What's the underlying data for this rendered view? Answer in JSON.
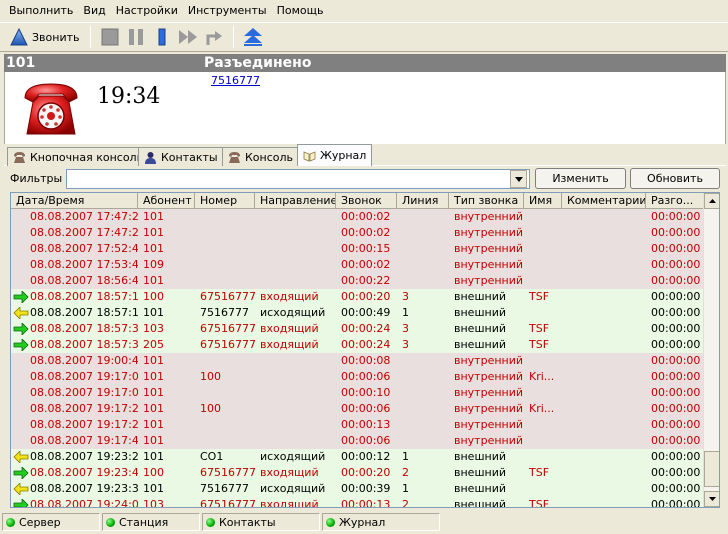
{
  "menu": [
    "Выполнить",
    "Вид",
    "Настройки",
    "Инструменты",
    "Помощь"
  ],
  "toolbar": {
    "call_label": "Звонить"
  },
  "call": {
    "line": "101",
    "state": "Разъединено",
    "time": "19:34",
    "number": "7516777"
  },
  "tabs": [
    {
      "label": "Кнопочная консоль",
      "icon": "phone-icon"
    },
    {
      "label": "Контакты",
      "icon": "person-icon"
    },
    {
      "label": "Консоль",
      "icon": "phone-icon"
    },
    {
      "label": "Журнал",
      "icon": "book-icon"
    }
  ],
  "filters": {
    "label": "Фильтры",
    "value": "",
    "edit_label": "Изменить",
    "refresh_label": "Обновить"
  },
  "columns": [
    "Дата/Время",
    "Абонент",
    "Номер",
    "Направление",
    "Звонок",
    "Линия",
    "Тип звонка",
    "Имя",
    "Комментарии",
    "Разго..."
  ],
  "rows": [
    {
      "dt": "08.08.2007 17:47:25",
      "sub": "101",
      "num": "",
      "dir": "",
      "dur": "00:00:02",
      "line": "",
      "type": "внутренний",
      "name": "",
      "comm": "",
      "talk": "00:00:00",
      "kind": "int",
      "arrow": ""
    },
    {
      "dt": "08.08.2007 17:47:28",
      "sub": "101",
      "num": "",
      "dir": "",
      "dur": "00:00:02",
      "line": "",
      "type": "внутренний",
      "name": "",
      "comm": "",
      "talk": "00:00:00",
      "kind": "int",
      "arrow": ""
    },
    {
      "dt": "08.08.2007 17:52:47",
      "sub": "101",
      "num": "",
      "dir": "",
      "dur": "00:00:15",
      "line": "",
      "type": "внутренний",
      "name": "",
      "comm": "",
      "talk": "00:00:00",
      "kind": "int",
      "arrow": ""
    },
    {
      "dt": "08.08.2007 17:53:42",
      "sub": "109",
      "num": "",
      "dir": "",
      "dur": "00:00:02",
      "line": "",
      "type": "внутренний",
      "name": "",
      "comm": "",
      "talk": "00:00:00",
      "kind": "int",
      "arrow": ""
    },
    {
      "dt": "08.08.2007 18:56:43",
      "sub": "101",
      "num": "",
      "dir": "",
      "dur": "00:00:22",
      "line": "",
      "type": "внутренний",
      "name": "",
      "comm": "",
      "talk": "00:00:00",
      "kind": "int",
      "arrow": ""
    },
    {
      "dt": "08.08.2007 18:57:16",
      "sub": "100",
      "num": "67516777",
      "dir": "входящий",
      "dur": "00:00:20",
      "line": "3",
      "type": "внешний",
      "name": "TSF",
      "comm": "",
      "talk": "00:00:00",
      "kind": "in",
      "arrow": "in"
    },
    {
      "dt": "08.08.2007 18:57:10",
      "sub": "101",
      "num": "7516777",
      "dir": "исходящий",
      "dur": "00:00:49",
      "line": "1",
      "type": "внешний",
      "name": "",
      "comm": "",
      "talk": "00:00:00",
      "kind": "out",
      "arrow": "out"
    },
    {
      "dt": "08.08.2007 18:57:36",
      "sub": "103",
      "num": "67516777",
      "dir": "входящий",
      "dur": "00:00:24",
      "line": "3",
      "type": "внешний",
      "name": "TSF",
      "comm": "",
      "talk": "00:00:00",
      "kind": "in",
      "arrow": "in"
    },
    {
      "dt": "08.08.2007 18:57:36",
      "sub": "205",
      "num": "67516777",
      "dir": "входящий",
      "dur": "00:00:24",
      "line": "3",
      "type": "внешний",
      "name": "TSF",
      "comm": "",
      "talk": "00:00:00",
      "kind": "in",
      "arrow": "in"
    },
    {
      "dt": "08.08.2007 19:00:40",
      "sub": "101",
      "num": "",
      "dir": "",
      "dur": "00:00:08",
      "line": "",
      "type": "внутренний",
      "name": "",
      "comm": "",
      "talk": "00:00:00",
      "kind": "int",
      "arrow": ""
    },
    {
      "dt": "08.08.2007 19:17:01",
      "sub": "101",
      "num": "100",
      "dir": "",
      "dur": "00:00:06",
      "line": "",
      "type": "внутренний",
      "name": "Kri...",
      "comm": "",
      "talk": "00:00:00",
      "kind": "int",
      "arrow": ""
    },
    {
      "dt": "08.08.2007 19:17:09",
      "sub": "101",
      "num": "",
      "dir": "",
      "dur": "00:00:10",
      "line": "",
      "type": "внутренний",
      "name": "",
      "comm": "",
      "talk": "00:00:00",
      "kind": "int",
      "arrow": ""
    },
    {
      "dt": "08.08.2007 19:17:21",
      "sub": "101",
      "num": "100",
      "dir": "",
      "dur": "00:00:06",
      "line": "",
      "type": "внутренний",
      "name": "Kri...",
      "comm": "",
      "talk": "00:00:00",
      "kind": "int",
      "arrow": ""
    },
    {
      "dt": "08.08.2007 19:17:28",
      "sub": "101",
      "num": "",
      "dir": "",
      "dur": "00:00:13",
      "line": "",
      "type": "внутренний",
      "name": "",
      "comm": "",
      "talk": "00:00:00",
      "kind": "int",
      "arrow": ""
    },
    {
      "dt": "08.08.2007 19:17:41",
      "sub": "101",
      "num": "",
      "dir": "",
      "dur": "00:00:06",
      "line": "",
      "type": "внутренний",
      "name": "",
      "comm": "",
      "talk": "00:00:00",
      "kind": "int",
      "arrow": ""
    },
    {
      "dt": "08.08.2007 19:23:23",
      "sub": "101",
      "num": "CO1",
      "dir": "исходящий",
      "dur": "00:00:12",
      "line": "1",
      "type": "внешний",
      "name": "",
      "comm": "",
      "talk": "00:00:00",
      "kind": "out",
      "arrow": "out"
    },
    {
      "dt": "08.08.2007 19:23:42",
      "sub": "100",
      "num": "67516777",
      "dir": "входящий",
      "dur": "00:00:20",
      "line": "2",
      "type": "внешний",
      "name": "TSF",
      "comm": "",
      "talk": "00:00:00",
      "kind": "in",
      "arrow": "in"
    },
    {
      "dt": "08.08.2007 19:23:36",
      "sub": "101",
      "num": "7516777",
      "dir": "исходящий",
      "dur": "00:00:39",
      "line": "1",
      "type": "внешний",
      "name": "",
      "comm": "",
      "talk": "00:00:00",
      "kind": "out",
      "arrow": "out"
    },
    {
      "dt": "08.08.2007 19:24:02",
      "sub": "103",
      "num": "67516777",
      "dir": "входящий",
      "dur": "00:00:13",
      "line": "2",
      "type": "внешний",
      "name": "TSF",
      "comm": "",
      "talk": "00:00:00",
      "kind": "in",
      "arrow": "in"
    }
  ],
  "statusbar": [
    "Сервер",
    "Станция",
    "Контакты",
    "Журнал"
  ]
}
